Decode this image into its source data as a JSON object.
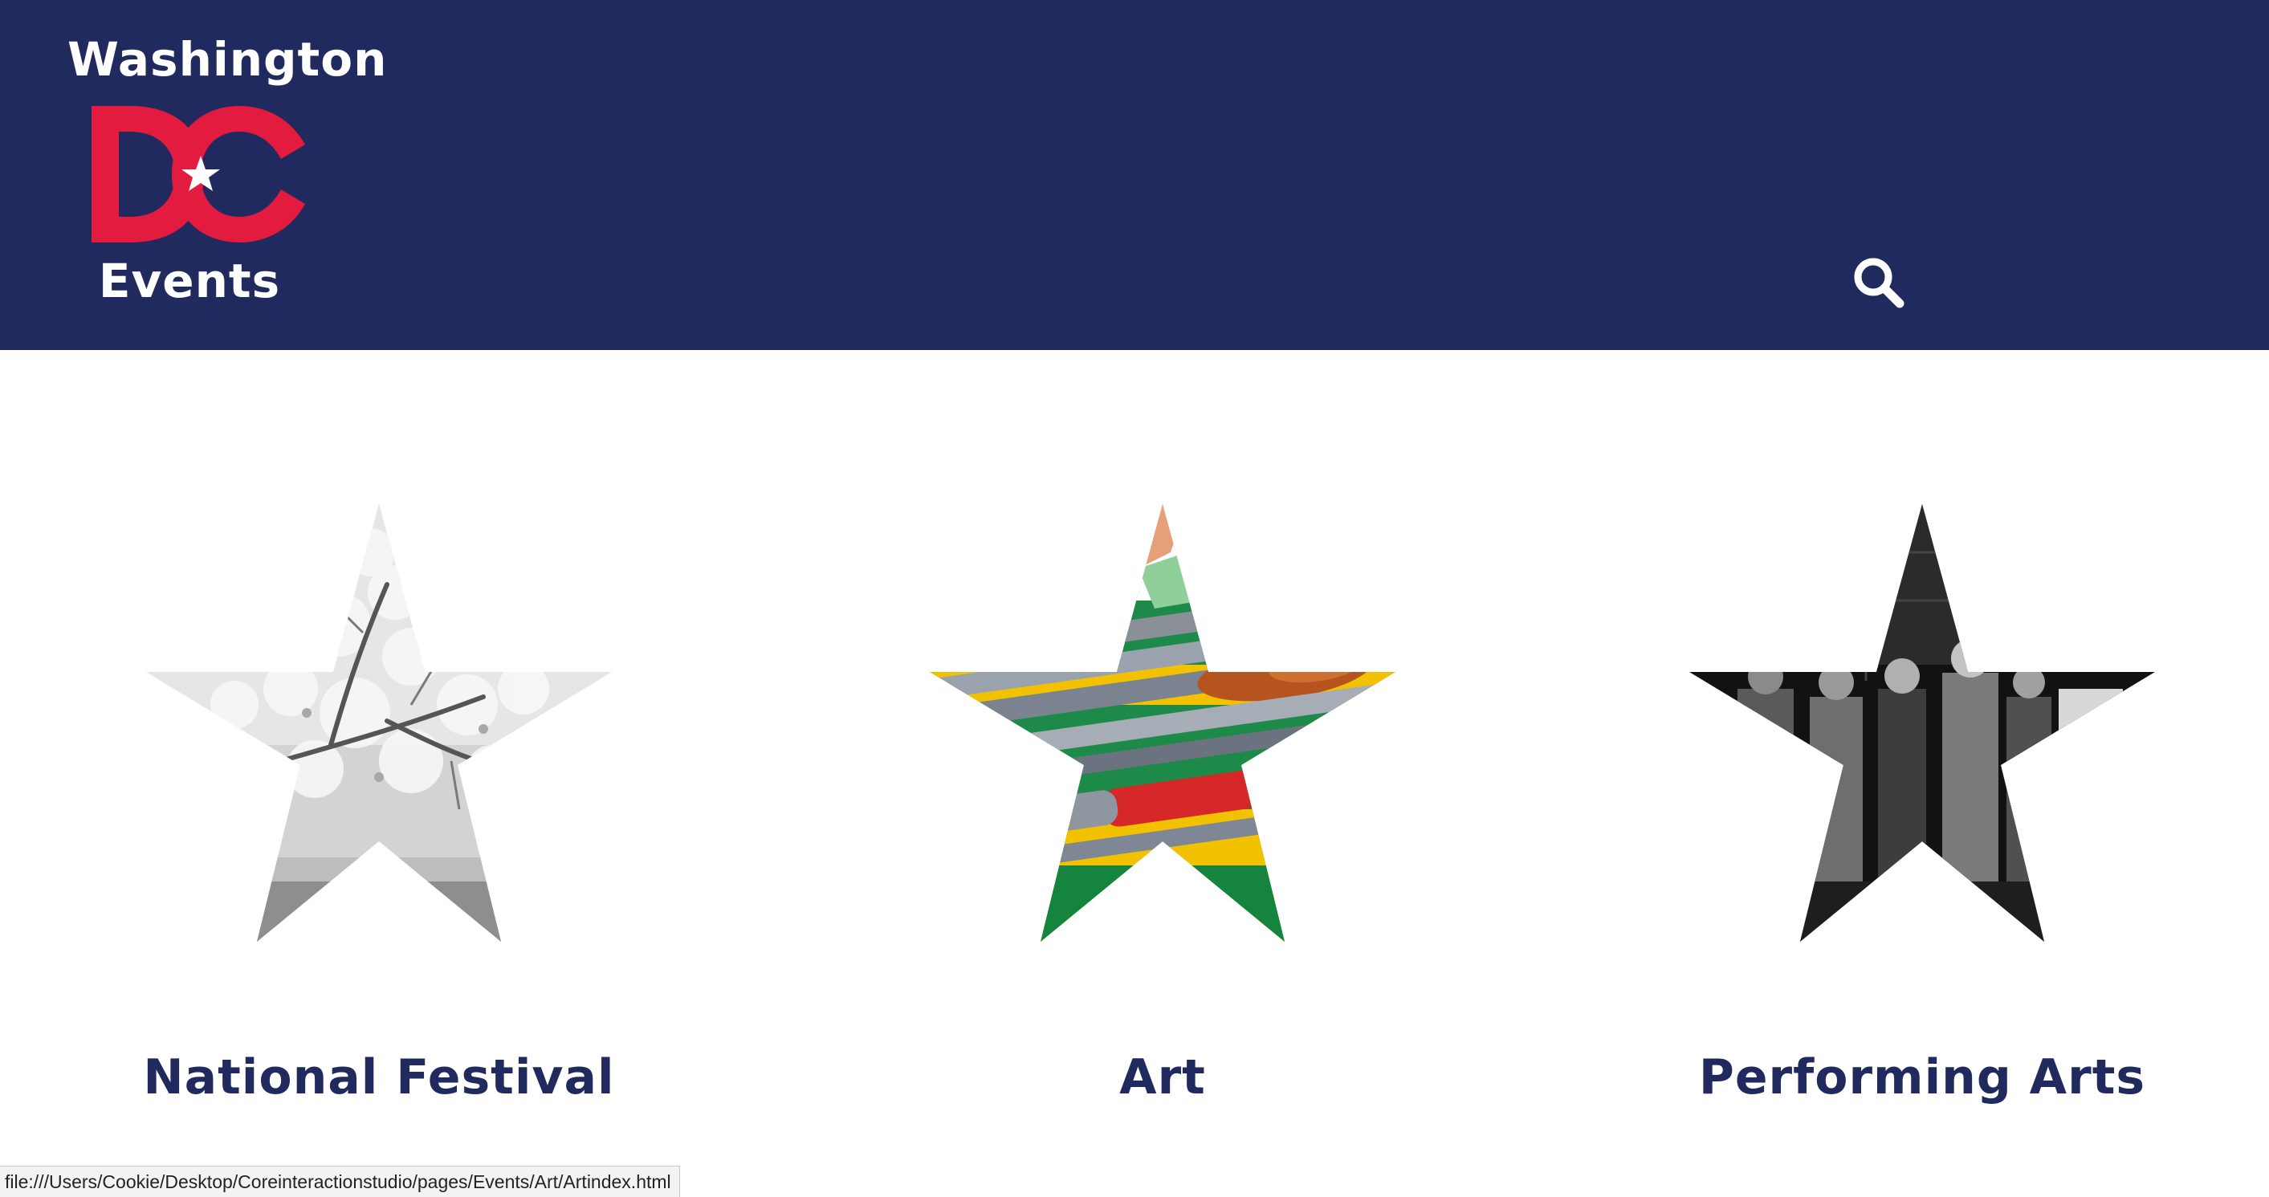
{
  "header": {
    "logo_top": "Washington",
    "logo_mark": "DC",
    "logo_bottom": "Events",
    "search_icon": "search-icon",
    "background_color": "#202a5e",
    "accent_color": "#e31b3f"
  },
  "categories": [
    {
      "label": "National Festival",
      "image": "cherry-blossom-photo"
    },
    {
      "label": "Art",
      "image": "paint-brushes-photo"
    },
    {
      "label": "Performing Arts",
      "image": "performers-photo"
    }
  ],
  "statusbar": {
    "url": "file:///Users/Cookie/Desktop/Coreinteractionstudio/pages/Events/Art/Artindex.html"
  }
}
